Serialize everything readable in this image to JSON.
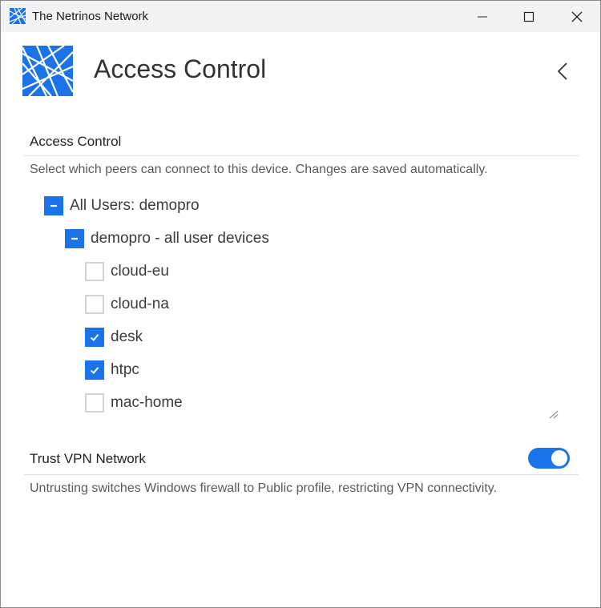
{
  "window": {
    "title": "The Netrinos Network",
    "controls": [
      "minimize",
      "maximize",
      "close"
    ]
  },
  "header": {
    "title": "Access Control",
    "logo_icon": "netrinos-logo-icon",
    "back_icon": "chevron-left-icon"
  },
  "access_control": {
    "section_title": "Access Control",
    "description": "Select which peers can connect to this device. Changes are saved automatically.",
    "tree": {
      "root": {
        "label": "All Users: demopro",
        "state": "indeterminate"
      },
      "group": {
        "label": "demopro - all user devices",
        "state": "indeterminate"
      },
      "devices": [
        {
          "label": "cloud-eu",
          "checked": false
        },
        {
          "label": "cloud-na",
          "checked": false
        },
        {
          "label": "desk",
          "checked": true
        },
        {
          "label": "htpc",
          "checked": true
        },
        {
          "label": "mac-home",
          "checked": false
        }
      ]
    }
  },
  "trust_vpn": {
    "section_title": "Trust VPN Network",
    "toggle_on": true,
    "description": "Untrusting switches Windows firewall to Public profile, restricting VPN connectivity."
  },
  "colors": {
    "accent": "#1a73e8",
    "titlebar": "#f3f3f3",
    "muted_text": "#5a5a5a"
  }
}
